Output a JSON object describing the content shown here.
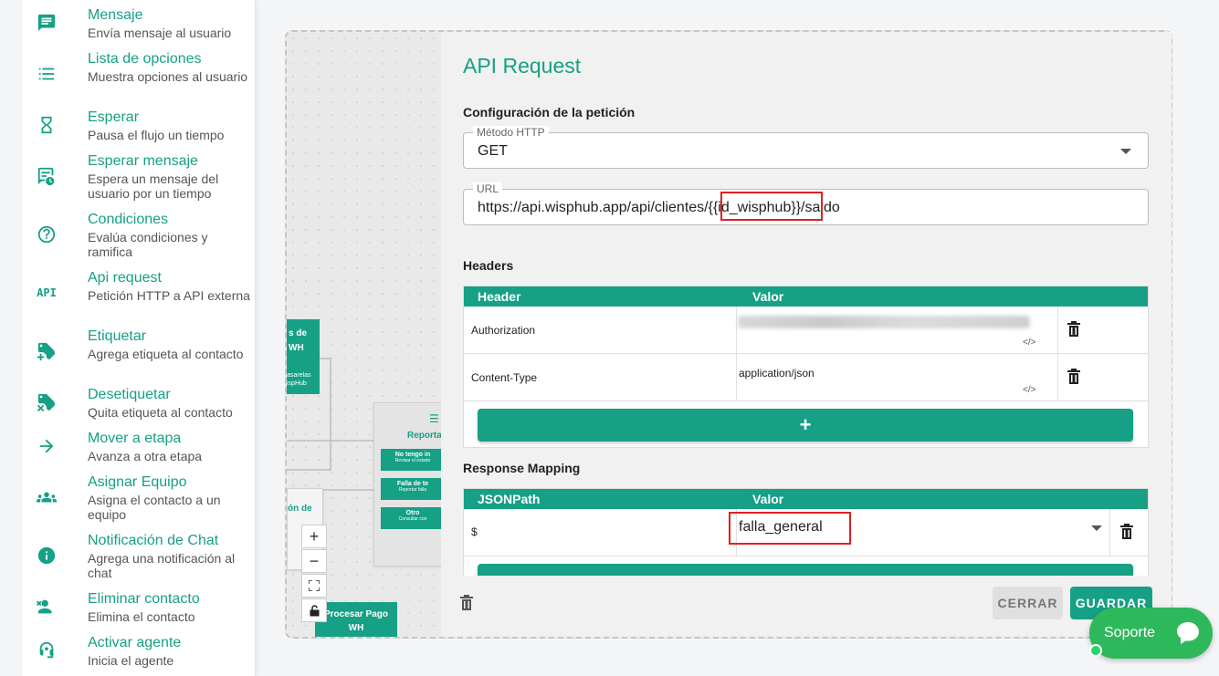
{
  "sidebar": {
    "items": [
      {
        "title": "Mensaje",
        "desc": "Envía mensaje al usuario",
        "icon": "chat-icon"
      },
      {
        "title": "Lista de opciones",
        "desc": "Muestra opciones al usuario",
        "icon": "list-icon"
      },
      {
        "title": "Esperar",
        "desc": "Pausa el flujo un tiempo",
        "icon": "hourglass-icon"
      },
      {
        "title": "Esperar mensaje",
        "desc": "Espera un mensaje del usuario por un tiempo",
        "icon": "message-clock-icon"
      },
      {
        "title": "Condiciones",
        "desc": "Evalúa condiciones y ramifica",
        "icon": "question-icon"
      },
      {
        "title": "Api request",
        "desc": "Petición HTTP a API externa",
        "icon": "api-icon",
        "icon_text": "API"
      },
      {
        "title": "Etiquetar",
        "desc": "Agrega etiqueta al contacto",
        "icon": "tag-add-icon"
      },
      {
        "title": "Desetiquetar",
        "desc": "Quita etiqueta al contacto",
        "icon": "tag-remove-icon"
      },
      {
        "title": "Mover a etapa",
        "desc": "Avanza a otra etapa",
        "icon": "arrow-right-icon"
      },
      {
        "title": "Asignar Equipo",
        "desc": "Asigna el contacto a un equipo",
        "icon": "group-icon"
      },
      {
        "title": "Notificación de Chat",
        "desc": "Agrega una notificación al chat",
        "icon": "info-icon"
      },
      {
        "title": "Eliminar contacto",
        "desc": "Elimina el contacto",
        "icon": "remove-user-icon"
      },
      {
        "title": "Activar agente",
        "desc": "Inicia el agente",
        "icon": "agent-icon"
      }
    ]
  },
  "canvas": {
    "node_left_top": "s de",
    "node_left_mid": "WH",
    "node_left_sub1": "asarelas",
    "node_left_sub2": "ispHub",
    "report_title": "Reportar",
    "report_opt1": "No tengo in",
    "report_opt1_sub": "Revisar el estado",
    "report_opt2": "Falla de te",
    "report_opt2_sub": "Reportar falla",
    "report_opt3": "Otro",
    "report_opt3_sub": "Consultar con",
    "node_bottom_left": "ón de",
    "process_node_line1": "Procesar Pago",
    "process_node_line2": "WH",
    "zoom_in": "+",
    "zoom_out": "−"
  },
  "panel": {
    "title": "API Request",
    "config_label": "Configuración de la petición",
    "method_label": "Método HTTP",
    "method_value": "GET",
    "url_label": "URL",
    "url_prefix": "https://api.wisphub.app/api/clientes/",
    "url_var": "{{id_wisphub}}",
    "url_suffix": "/saldo",
    "headers_label": "Headers",
    "headers_cols": [
      "Header",
      "Valor"
    ],
    "headers_rows": [
      {
        "key": "Authorization",
        "value": ""
      },
      {
        "key": "Content-Type",
        "value": "application/json"
      }
    ],
    "add_label": "+",
    "mapping_label": "Response Mapping",
    "mapping_cols": [
      "JSONPath",
      "Valor"
    ],
    "mapping_rows": [
      {
        "key": "$",
        "value": "falla_general"
      }
    ],
    "mini_icons": "</>",
    "close_label": "CERRAR",
    "save_label": "GUARDAR"
  },
  "support": {
    "label": "Soporte"
  },
  "colors": {
    "accent": "#16a085",
    "highlight": "#e02020",
    "support": "#2eb85c"
  }
}
